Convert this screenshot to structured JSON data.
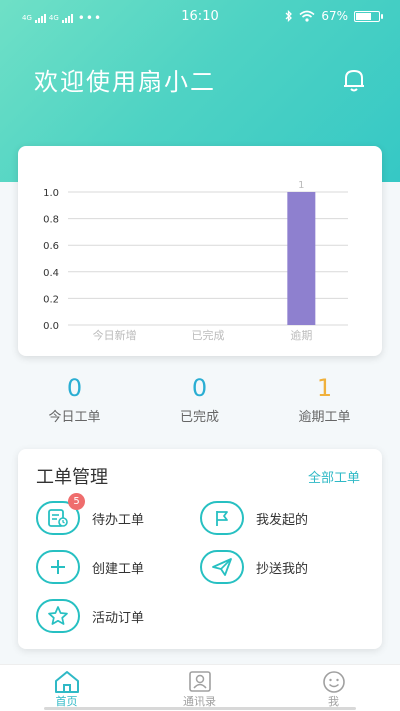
{
  "status_bar": {
    "sim1": "4G",
    "sim2": "4G",
    "dots": "•••",
    "time": "16:10",
    "battery": "67%",
    "battery_fraction": 0.67
  },
  "header": {
    "title": "欢迎使用扇小二",
    "icon": "bell-icon"
  },
  "chart_data": {
    "type": "bar",
    "categories": [
      "今日新增",
      "已完成",
      "逾期"
    ],
    "values": [
      0,
      0,
      1
    ],
    "data_labels": [
      "",
      "",
      "1"
    ],
    "yticks": [
      "0.0",
      "0.2",
      "0.4",
      "0.6",
      "0.8",
      "1.0"
    ],
    "ylim": [
      0,
      1
    ],
    "grid": true,
    "bar_color": "#8e80cf"
  },
  "stats": [
    {
      "value": "0",
      "label": "今日工单",
      "color": "#2aaed3"
    },
    {
      "value": "0",
      "label": "已完成",
      "color": "#2aaed3"
    },
    {
      "value": "1",
      "label": "逾期工单",
      "color": "#f0b13c"
    }
  ],
  "management": {
    "title": "工单管理",
    "all_link": "全部工单",
    "items": [
      {
        "label": "待办工单",
        "icon": "todo-list-icon",
        "badge": "5"
      },
      {
        "label": "我发起的",
        "icon": "flag-icon"
      },
      {
        "label": "创建工单",
        "icon": "plus-icon"
      },
      {
        "label": "抄送我的",
        "icon": "paper-plane-icon"
      },
      {
        "label": "活动订单",
        "icon": "star-icon"
      }
    ]
  },
  "tabs": [
    {
      "label": "首页",
      "icon": "home-icon",
      "active": true
    },
    {
      "label": "通讯录",
      "icon": "contacts-icon",
      "active": false
    },
    {
      "label": "我",
      "icon": "smiley-icon",
      "active": false
    }
  ],
  "colors": {
    "accent": "#27c0c2",
    "tab_active": "#2fb9c6",
    "tab_inactive": "#a0a0a0"
  }
}
